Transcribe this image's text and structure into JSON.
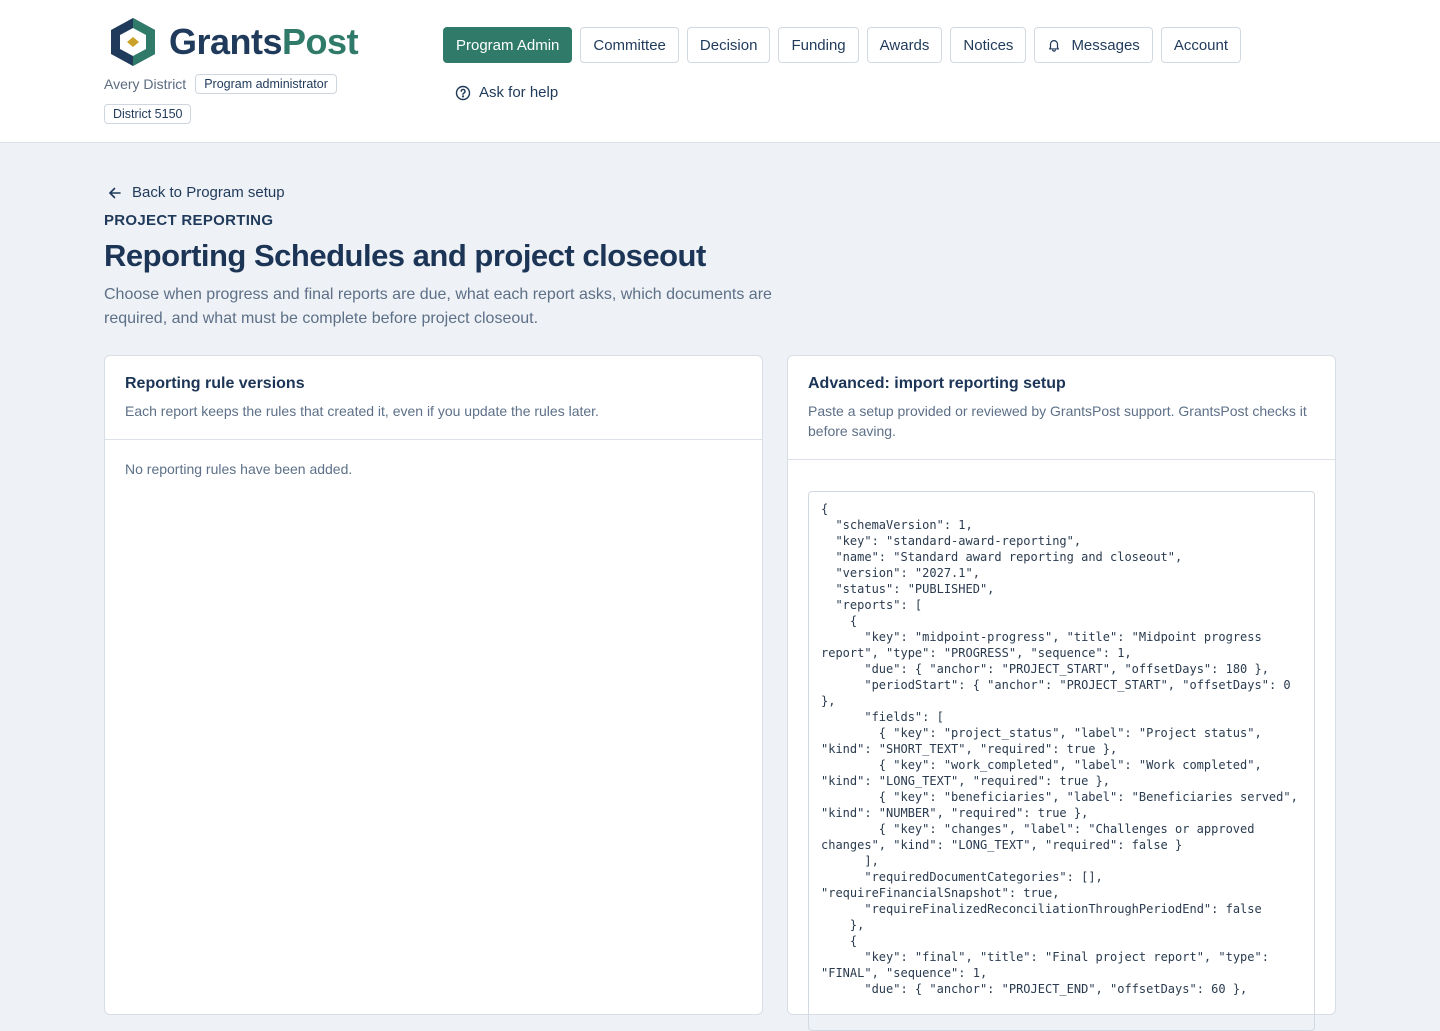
{
  "brand": {
    "name_part1": "Grants",
    "name_part2": "Post"
  },
  "org": {
    "name": "Avery District",
    "role": "Program administrator",
    "district": "District 5150"
  },
  "nav": {
    "items": [
      {
        "label": "Program Admin"
      },
      {
        "label": "Committee"
      },
      {
        "label": "Decision"
      },
      {
        "label": "Funding"
      },
      {
        "label": "Awards"
      },
      {
        "label": "Notices"
      },
      {
        "label": "Messages"
      },
      {
        "label": "Account"
      }
    ],
    "active": "Program Admin",
    "help_label": "Ask for help"
  },
  "page": {
    "back_label": "Back to Program setup",
    "eyebrow": "PROJECT REPORTING",
    "title": "Reporting Schedules and project closeout",
    "description": "Choose when progress and final reports are due, what each report asks, which documents are required, and what must be complete before project closeout."
  },
  "rules_card": {
    "title": "Reporting rule versions",
    "subtitle": "Each report keeps the rules that created it, even if you update the rules later.",
    "empty_message": "No reporting rules have been added."
  },
  "import_card": {
    "title": "Advanced: import reporting setup",
    "subtitle": "Paste a setup provided or reviewed by GrantsPost support. GrantsPost checks it before saving.",
    "json_text": "{\n  \"schemaVersion\": 1,\n  \"key\": \"standard-award-reporting\",\n  \"name\": \"Standard award reporting and closeout\",\n  \"version\": \"2027.1\",\n  \"status\": \"PUBLISHED\",\n  \"reports\": [\n    {\n      \"key\": \"midpoint-progress\", \"title\": \"Midpoint progress report\", \"type\": \"PROGRESS\", \"sequence\": 1,\n      \"due\": { \"anchor\": \"PROJECT_START\", \"offsetDays\": 180 },\n      \"periodStart\": { \"anchor\": \"PROJECT_START\", \"offsetDays\": 0 },\n      \"fields\": [\n        { \"key\": \"project_status\", \"label\": \"Project status\", \"kind\": \"SHORT_TEXT\", \"required\": true },\n        { \"key\": \"work_completed\", \"label\": \"Work completed\", \"kind\": \"LONG_TEXT\", \"required\": true },\n        { \"key\": \"beneficiaries\", \"label\": \"Beneficiaries served\", \"kind\": \"NUMBER\", \"required\": true },\n        { \"key\": \"changes\", \"label\": \"Challenges or approved changes\", \"kind\": \"LONG_TEXT\", \"required\": false }\n      ],\n      \"requiredDocumentCategories\": [], \"requireFinancialSnapshot\": true,\n      \"requireFinalizedReconciliationThroughPeriodEnd\": false\n    },\n    {\n      \"key\": \"final\", \"title\": \"Final project report\", \"type\": \"FINAL\", \"sequence\": 1,\n      \"due\": { \"anchor\": \"PROJECT_END\", \"offsetDays\": 60 },"
  }
}
